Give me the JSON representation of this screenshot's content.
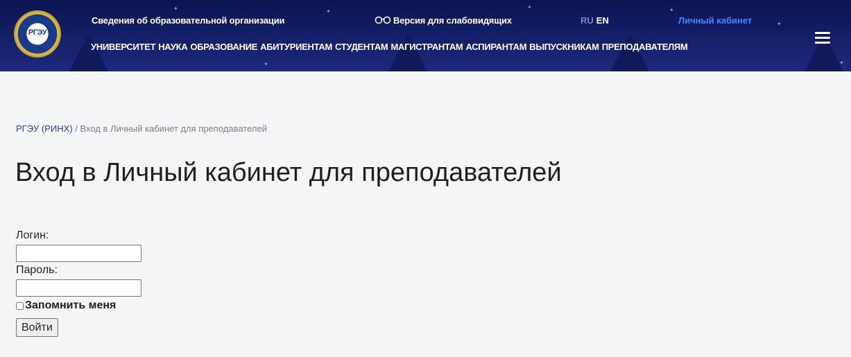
{
  "header": {
    "info_link": "Сведения об образовательной организации",
    "vision_icon": "glasses-icon",
    "vision_link": "Версия для слабовидящих",
    "lang_ru": "RU",
    "lang_en": "EN",
    "cabinet_link": "Личный кабинет",
    "logo_text": "РГЭУ",
    "menu_icon": "hamburger-menu-icon",
    "colors": {
      "background": "#15206a",
      "cabinet_link": "#3f8bff",
      "lang_active": "#6a8ad8"
    }
  },
  "nav": {
    "items": [
      "УНИВЕРСИТЕТ",
      "НАУКА",
      "ОБРАЗОВАНИЕ",
      "АБИТУРИЕНТАМ",
      "СТУДЕНТАМ",
      "МАГИСТРАНТАМ",
      "АСПИРАНТАМ",
      "ВЫПУСКНИКАМ",
      "ПРЕПОДАВАТЕЛЯМ"
    ]
  },
  "breadcrumb": {
    "home": "РГЭУ (РИНХ)",
    "separator": " / ",
    "current": "Вход в Личный кабинет для преподавателей"
  },
  "page": {
    "title": "Вход в Личный кабинет для преподавателей"
  },
  "form": {
    "login_label": "Логин:",
    "login_value": "",
    "password_label": "Пароль:",
    "password_value": "",
    "remember_label": "Запомнить меня",
    "remember_checked": false,
    "submit_label": "Войти"
  }
}
